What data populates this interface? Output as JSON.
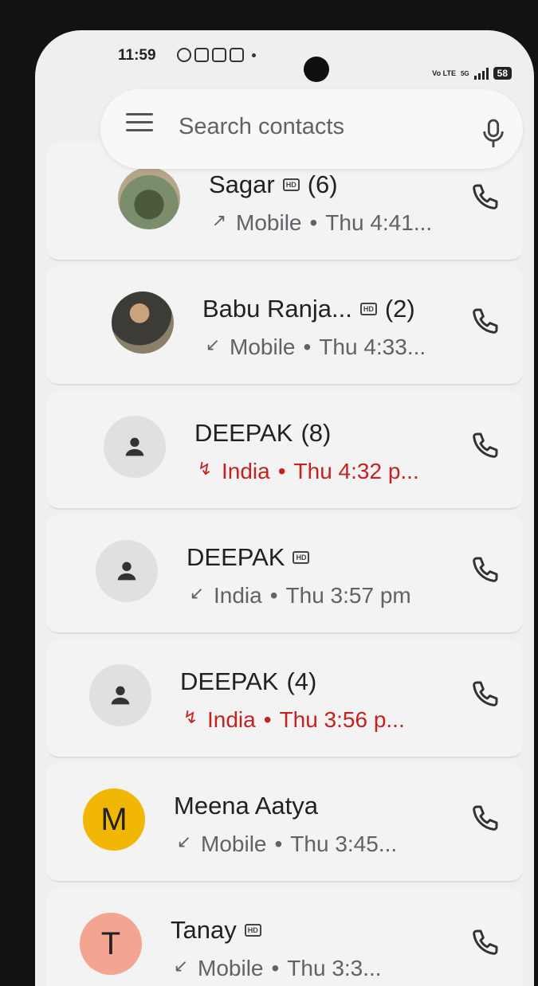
{
  "status_bar": {
    "time": "11:59",
    "network": "5G",
    "volte": "Vo LTE",
    "battery": "58"
  },
  "search": {
    "placeholder": "Search contacts"
  },
  "calls": [
    {
      "name": "Sagar",
      "hd": true,
      "count": "(6)",
      "direction": "outgoing",
      "type": "Mobile",
      "time": "Thu 4:41...",
      "missed": false,
      "avatar": "photo2"
    },
    {
      "name": "Babu Ranja...",
      "hd": true,
      "count": "(2)",
      "direction": "incoming",
      "type": "Mobile",
      "time": "Thu 4:33...",
      "missed": false,
      "avatar": "photo"
    },
    {
      "name": "DEEPAK",
      "hd": false,
      "count": "(8)",
      "direction": "missed",
      "type": "India",
      "time": "Thu 4:32 p...",
      "missed": true,
      "avatar": "generic"
    },
    {
      "name": "DEEPAK",
      "hd": true,
      "count": "",
      "direction": "incoming",
      "type": "India",
      "time": "Thu 3:57 pm",
      "missed": false,
      "avatar": "generic"
    },
    {
      "name": "DEEPAK",
      "hd": false,
      "count": "(4)",
      "direction": "missed",
      "type": "India",
      "time": "Thu 3:56 p...",
      "missed": true,
      "avatar": "generic"
    },
    {
      "name": "Meena Aatya",
      "hd": false,
      "count": "",
      "direction": "incoming",
      "type": "Mobile",
      "time": "Thu 3:45...",
      "missed": false,
      "avatar": "M"
    },
    {
      "name": "Tanay",
      "hd": true,
      "count": "",
      "direction": "incoming",
      "type": "Mobile",
      "time": "Thu 3:3...",
      "missed": false,
      "avatar": "T"
    }
  ],
  "icons": {
    "menu": "hamburger-icon",
    "mic": "microphone-icon",
    "call": "phone-icon",
    "person": "person-icon",
    "outgoing": "arrow-up-right-icon",
    "incoming": "arrow-down-left-icon",
    "missed": "missed-call-icon",
    "hd": "hd-icon"
  },
  "colors": {
    "missed": "#c5221f",
    "m_avatar": "#f2b705",
    "t_avatar": "#f3a592"
  }
}
